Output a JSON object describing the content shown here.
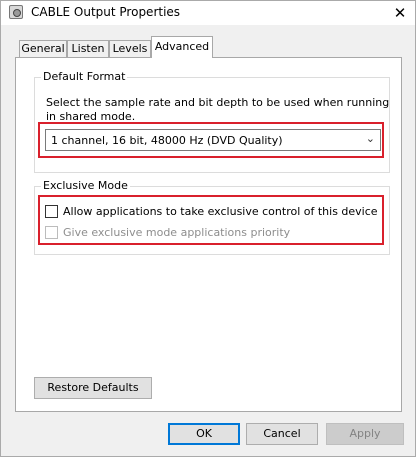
{
  "window": {
    "title": "CABLE Output Properties",
    "close_glyph": "✕",
    "icon": "speaker-device-icon"
  },
  "tabs": [
    {
      "label": "General",
      "active": false
    },
    {
      "label": "Listen",
      "active": false
    },
    {
      "label": "Levels",
      "active": false
    },
    {
      "label": "Advanced",
      "active": true
    }
  ],
  "default_format": {
    "heading": "Default Format",
    "description": "Select the sample rate and bit depth to be used when running in shared mode.",
    "selected_format": "1 channel, 16 bit, 48000 Hz (DVD Quality)",
    "dropdown_icon": "chevron-down-icon",
    "dropdown_glyph": "⌄"
  },
  "exclusive_mode": {
    "heading": "Exclusive Mode",
    "allow_exclusive": {
      "label": "Allow applications to take exclusive control of this device",
      "checked": false,
      "enabled": true
    },
    "priority": {
      "label": "Give exclusive mode applications priority",
      "checked": false,
      "enabled": false
    }
  },
  "buttons": {
    "restore_defaults": "Restore Defaults",
    "ok": "OK",
    "cancel": "Cancel",
    "apply": "Apply"
  },
  "colors": {
    "highlight": "#d9202c",
    "default_button_border": "#0078d7",
    "window_background": "#f0f0f0",
    "panel_background": "#ffffff"
  }
}
